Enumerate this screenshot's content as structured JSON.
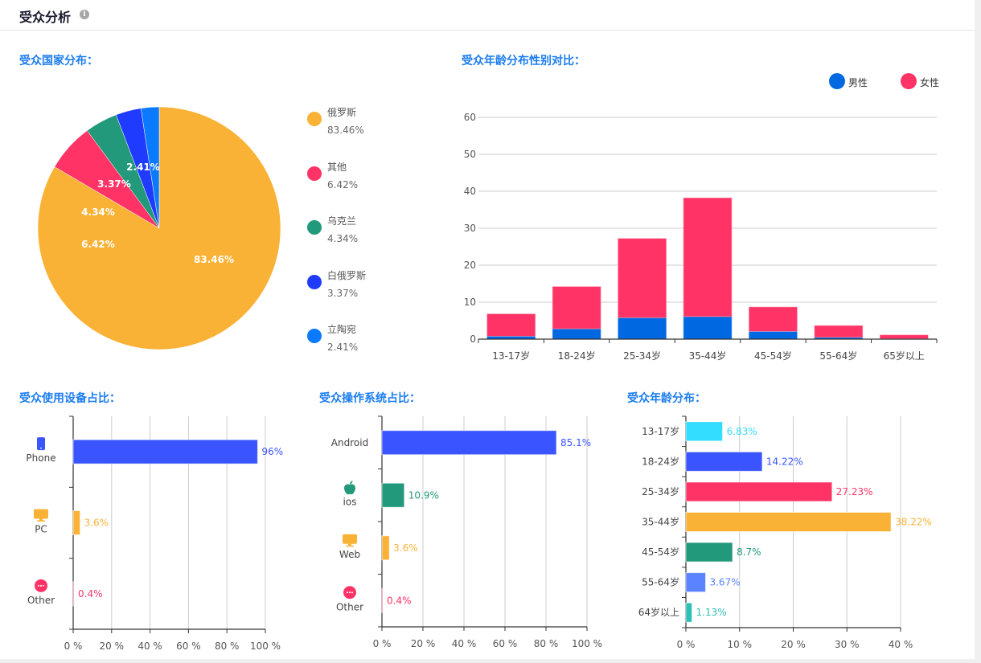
{
  "header": {
    "title": "受众分析",
    "info_icon": "info-icon"
  },
  "sections": {
    "country": "受众国家分布：",
    "gender_age": "受众年龄分布性别对比：",
    "device": "受众使用设备占比：",
    "os": "受众操作系统占比：",
    "age": "受众年龄分布："
  },
  "chart_data": [
    {
      "id": "country",
      "type": "pie",
      "title": "受众国家分布：",
      "legend_position": "right",
      "slices": [
        {
          "label": "俄罗斯",
          "value": 83.46,
          "display": "83.46%",
          "color": "#f9b236"
        },
        {
          "label": "其他",
          "value": 6.42,
          "display": "6.42%",
          "color": "#ff3366"
        },
        {
          "label": "乌克兰",
          "value": 4.34,
          "display": "4.34%",
          "color": "#22997a"
        },
        {
          "label": "白俄罗斯",
          "value": 3.37,
          "display": "3.37%",
          "color": "#1f3bff"
        },
        {
          "label": "立陶宛",
          "value": 2.41,
          "display": "2.41%",
          "color": "#0a7aff"
        }
      ]
    },
    {
      "id": "gender_age",
      "type": "bar",
      "stacked": true,
      "title": "受众年龄分布性别对比：",
      "legend_position": "top-right",
      "categories": [
        "13-17岁",
        "18-24岁",
        "25-34岁",
        "35-44岁",
        "45-54岁",
        "55-64岁",
        "65岁以上"
      ],
      "series": [
        {
          "name": "男性",
          "color": "#0068e0",
          "values": [
            0.8,
            2.8,
            5.8,
            6.1,
            2.1,
            0.5,
            0.1
          ]
        },
        {
          "name": "女性",
          "color": "#ff3366",
          "values": [
            6.03,
            11.42,
            21.43,
            32.12,
            6.6,
            3.17,
            1.03
          ]
        }
      ],
      "yticks": [
        0,
        10,
        20,
        30,
        40,
        50,
        60
      ],
      "ylim": [
        0,
        60
      ],
      "grid": true
    },
    {
      "id": "device",
      "type": "bar",
      "orientation": "horizontal",
      "title": "受众使用设备占比：",
      "categories": [
        {
          "label": "Phone",
          "icon": "phone-icon",
          "value": 96,
          "display": "96%",
          "color": "#3a55ff"
        },
        {
          "label": "PC",
          "icon": "monitor-icon",
          "value": 3.6,
          "display": "3.6%",
          "color": "#f9b236"
        },
        {
          "label": "Other",
          "icon": "more-icon",
          "value": 0.4,
          "display": "0.4%",
          "color": "#ff3366"
        }
      ],
      "xticks": [
        "0 %",
        "20 %",
        "40 %",
        "60 %",
        "80 %",
        "100 %"
      ],
      "xlim": [
        0,
        100
      ],
      "grid": true
    },
    {
      "id": "os",
      "type": "bar",
      "orientation": "horizontal",
      "title": "受众操作系统占比：",
      "categories": [
        {
          "label": "Android",
          "icon": "",
          "value": 85.1,
          "display": "85.1%",
          "color": "#3a55ff"
        },
        {
          "label": "ios",
          "icon": "apple-icon",
          "value": 10.9,
          "display": "10.9%",
          "color": "#22997a"
        },
        {
          "label": "Web",
          "icon": "monitor-icon",
          "value": 3.6,
          "display": "3.6%",
          "color": "#f9b236"
        },
        {
          "label": "Other",
          "icon": "more-icon",
          "value": 0.4,
          "display": "0.4%",
          "color": "#ff3366"
        }
      ],
      "xticks": [
        "0 %",
        "20 %",
        "40 %",
        "60 %",
        "80 %",
        "100 %"
      ],
      "xlim": [
        0,
        100
      ],
      "grid": true
    },
    {
      "id": "age",
      "type": "bar",
      "orientation": "horizontal",
      "title": "受众年龄分布：",
      "categories": [
        {
          "label": "13-17岁",
          "value": 6.83,
          "display": "6.83%",
          "color": "#33ddff"
        },
        {
          "label": "18-24岁",
          "value": 14.22,
          "display": "14.22%",
          "color": "#3a55ff"
        },
        {
          "label": "25-34岁",
          "value": 27.23,
          "display": "27.23%",
          "color": "#ff3366"
        },
        {
          "label": "35-44岁",
          "value": 38.22,
          "display": "38.22%",
          "color": "#f9b236"
        },
        {
          "label": "45-54岁",
          "value": 8.7,
          "display": "8.7%",
          "color": "#22997a"
        },
        {
          "label": "55-64岁",
          "value": 3.67,
          "display": "3.67%",
          "color": "#5b82ff"
        },
        {
          "label": "64岁以上",
          "value": 1.13,
          "display": "1.13%",
          "color": "#2ebfb5"
        }
      ],
      "xticks": [
        "0 %",
        "10 %",
        "20 %",
        "30 %",
        "40 %"
      ],
      "xlim": [
        0,
        40
      ],
      "grid": true
    }
  ]
}
